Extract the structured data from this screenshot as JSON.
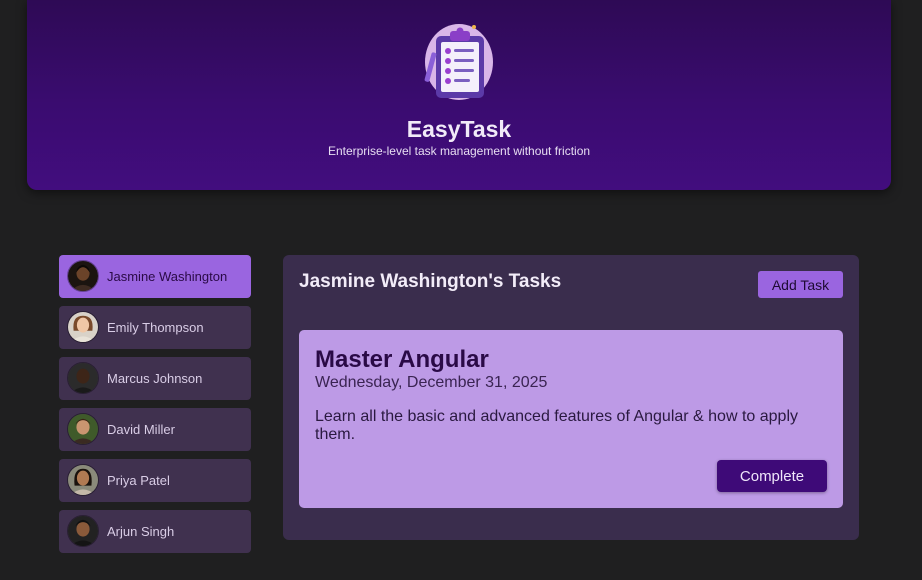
{
  "header": {
    "logo_icon": "clipboard-checklist-icon",
    "title": "EasyTask",
    "subtitle": "Enterprise-level task management without friction"
  },
  "users": [
    {
      "name": "Jasmine Washington",
      "active": true,
      "avatar_icon": "user-avatar"
    },
    {
      "name": "Emily Thompson",
      "active": false,
      "avatar_icon": "user-avatar"
    },
    {
      "name": "Marcus Johnson",
      "active": false,
      "avatar_icon": "user-avatar"
    },
    {
      "name": "David Miller",
      "active": false,
      "avatar_icon": "user-avatar"
    },
    {
      "name": "Priya Patel",
      "active": false,
      "avatar_icon": "user-avatar"
    },
    {
      "name": "Arjun Singh",
      "active": false,
      "avatar_icon": "user-avatar"
    }
  ],
  "tasks": {
    "title": "Jasmine Washington's Tasks",
    "add_label": "Add Task",
    "items": [
      {
        "title": "Master Angular",
        "due_date": "Wednesday, December 31, 2025",
        "summary": "Learn all the basic and advanced features of Angular & how to apply them.",
        "complete_label": "Complete"
      }
    ]
  },
  "colors": {
    "background": "#1f1f20",
    "header": "#3a0c70",
    "accent": "#9a65e0",
    "card": "#bd9ae6",
    "button_dark": "#3e0a78"
  }
}
